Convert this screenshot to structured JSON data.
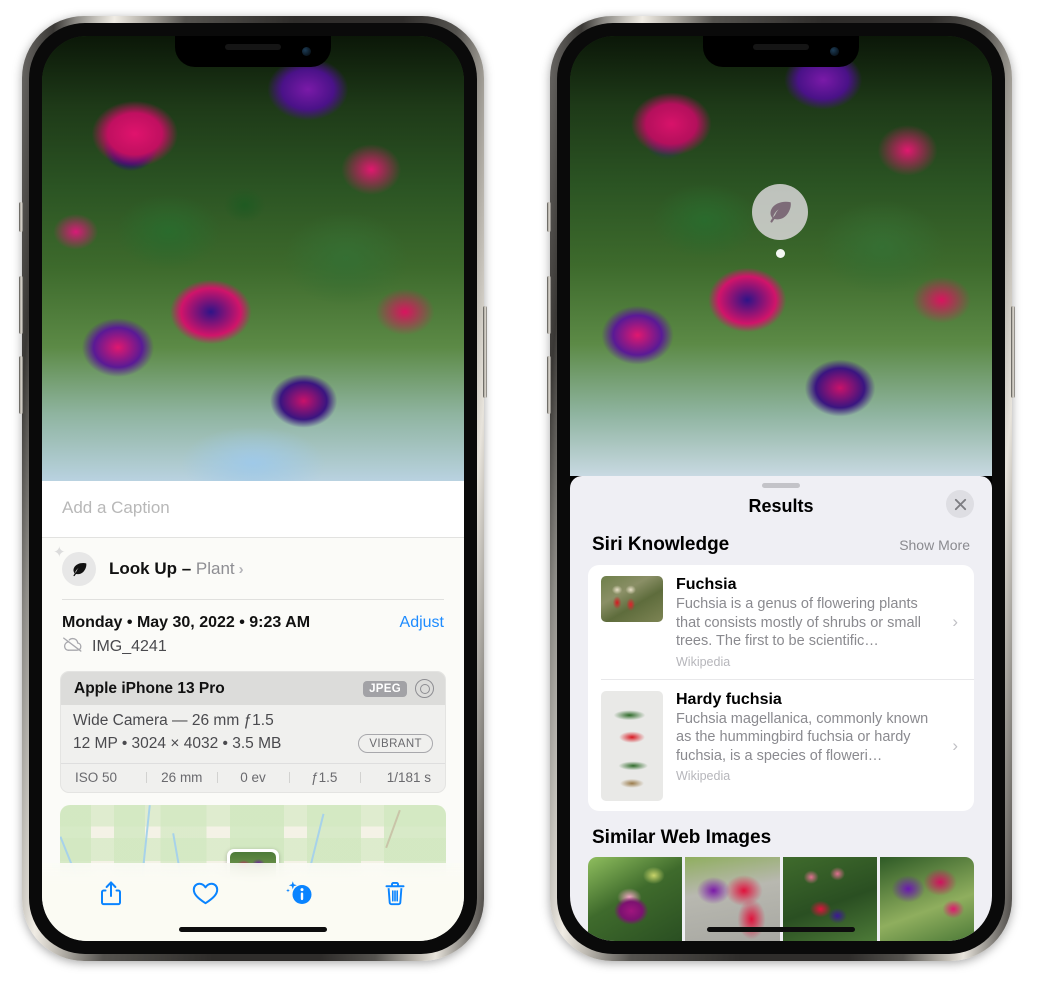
{
  "left_phone": {
    "name": "iPhone showing Photos app info view",
    "caption": {
      "placeholder": "Add a Caption",
      "value": ""
    },
    "lookup": {
      "icon": "leaf-icon",
      "sparkle_icon": "sparkle-icon",
      "label": "Look Up",
      "separator": " – ",
      "subject": "Plant",
      "chevron": "›"
    },
    "meta": {
      "date": "Monday • May 30, 2022 • 9:23 AM",
      "adjust_label": "Adjust",
      "cloud_icon": "cloud-slash-icon",
      "filename": "IMG_4241"
    },
    "exif": {
      "device": "Apple iPhone 13 Pro",
      "format_chip": "JPEG",
      "aperture_icon": "aperture-icon",
      "lens_line": "Wide Camera — 26 mm ƒ1.5",
      "size_line": "12 MP • 3024 × 4032 • 3.5 MB",
      "style_chip": "VIBRANT",
      "stats": [
        "ISO 50",
        "26 mm",
        "0 ev",
        "ƒ1.5",
        "1/181 s"
      ]
    },
    "toolbar": [
      {
        "name": "share-icon",
        "label": "Share"
      },
      {
        "name": "heart-icon",
        "label": "Favorite"
      },
      {
        "name": "info-sparkle-icon",
        "label": "Info"
      },
      {
        "name": "trash-icon",
        "label": "Delete"
      }
    ],
    "accent_color": "#1d8bff"
  },
  "right_phone": {
    "name": "iPhone showing Visual Look Up results",
    "photo_badge": {
      "icon": "leaf-icon",
      "label": "Plant subject indicator"
    },
    "sheet": {
      "grabber": "drag-handle",
      "title": "Results",
      "close_icon": "close-icon",
      "siri_section": {
        "title": "Siri Knowledge",
        "action": "Show More",
        "items": [
          {
            "thumb": "fuchsia-thumbnail",
            "title": "Fuchsia",
            "desc": "Fuchsia is a genus of flowering plants that consists mostly of shrubs or small trees. The first to be scientific…",
            "source": "Wikipedia",
            "chevron": "›"
          },
          {
            "thumb": "hardy-fuchsia-thumbnail",
            "title": "Hardy fuchsia",
            "desc": "Fuchsia magellanica, commonly known as the hummingbird fuchsia or hardy fuchsia, is a species of floweri…",
            "source": "Wikipedia",
            "chevron": "›"
          }
        ]
      },
      "web_section": {
        "title": "Similar Web Images",
        "images": [
          {
            "name": "web-image-1"
          },
          {
            "name": "web-image-2"
          },
          {
            "name": "web-image-3"
          },
          {
            "name": "web-image-4"
          }
        ]
      }
    }
  }
}
